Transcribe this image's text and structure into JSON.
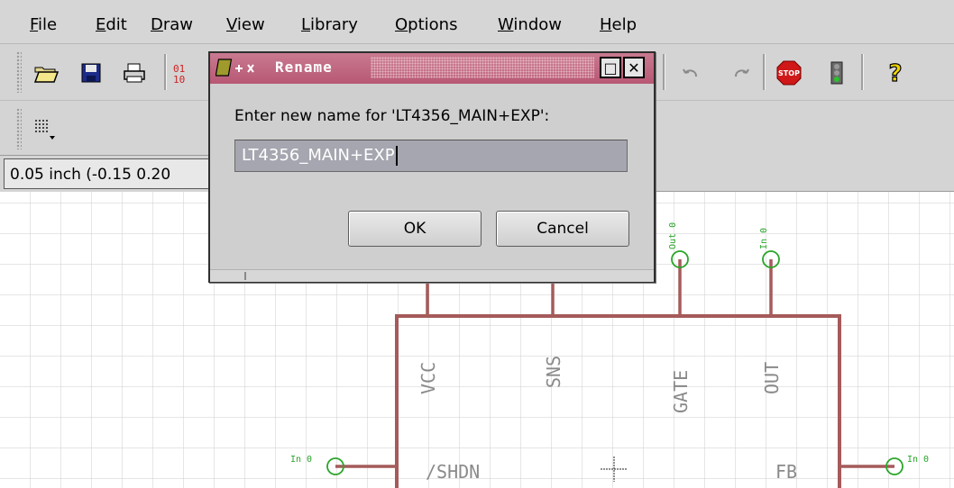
{
  "menu": {
    "items": [
      {
        "label": "File",
        "mnemonic": "F",
        "rest": "ile"
      },
      {
        "label": "Edit",
        "mnemonic": "E",
        "rest": "dit"
      },
      {
        "label": "Draw",
        "mnemonic": "D",
        "rest": "raw"
      },
      {
        "label": "View",
        "mnemonic": "V",
        "rest": "iew"
      },
      {
        "label": "Library",
        "mnemonic": "L",
        "rest": "ibrary"
      },
      {
        "label": "Options",
        "mnemonic": "O",
        "rest": "ptions"
      },
      {
        "label": "Window",
        "mnemonic": "W",
        "rest": "indow"
      },
      {
        "label": "Help",
        "mnemonic": "H",
        "rest": "elp"
      }
    ]
  },
  "toolbar": {
    "icons": [
      "open-icon",
      "save-icon",
      "print-icon",
      "undo-icon",
      "redo-icon",
      "stop-icon",
      "traffic-light-icon",
      "help-icon"
    ],
    "stop_label": "STOP",
    "help_label": "?"
  },
  "status": {
    "coordinates": "0.05 inch (-0.15 0.20"
  },
  "dialog": {
    "title": "Rename",
    "prompt": "Enter new name for 'LT4356_MAIN+EXP':",
    "value": "LT4356_MAIN+EXP",
    "ok_label": "OK",
    "cancel_label": "Cancel",
    "maximize_glyph": "□",
    "close_glyph": "✕"
  },
  "schematic": {
    "pins_top": [
      "VCC",
      "SNS",
      "GATE",
      "OUT"
    ],
    "pins_bottom": [
      "/SHDN",
      "FB"
    ],
    "pin_tags": [
      "Out 0",
      "In 0",
      "In 0",
      "In 0"
    ],
    "colors": {
      "wire": "#a85a5a",
      "pin": "#1ea51e",
      "grid": "#c8c8c8",
      "label": "#8a8a8a"
    }
  }
}
